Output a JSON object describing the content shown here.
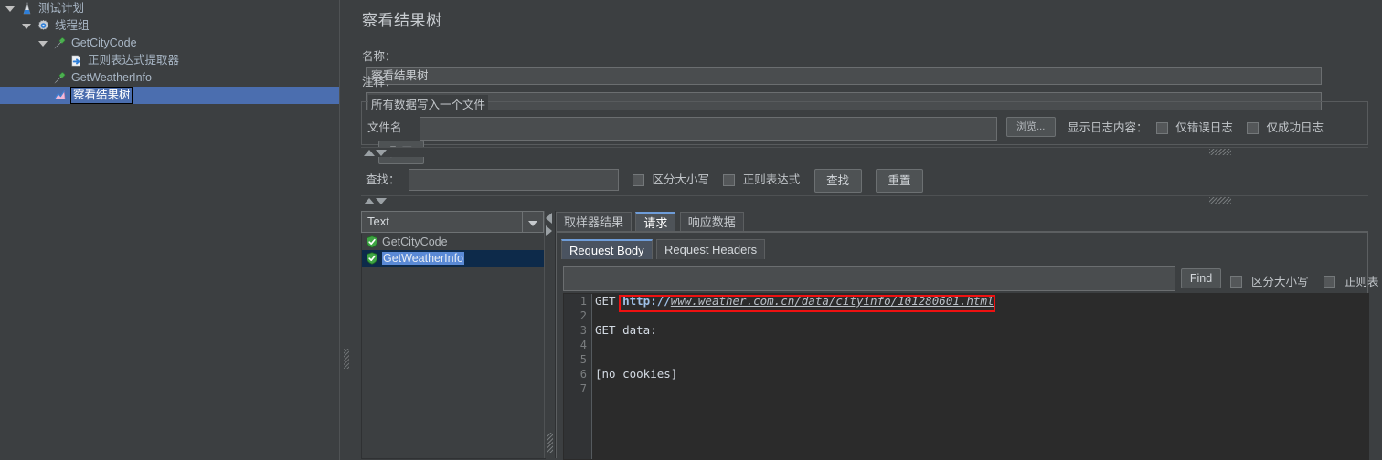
{
  "tree": {
    "items": [
      {
        "label": "测试计划",
        "icon": "test-plan-icon",
        "indent": 0,
        "toggle": "open",
        "selected": false
      },
      {
        "label": "线程组",
        "icon": "thread-group-icon",
        "indent": 1,
        "toggle": "open",
        "selected": false
      },
      {
        "label": "GetCityCode",
        "icon": "http-request-icon",
        "indent": 2,
        "toggle": "open",
        "selected": false
      },
      {
        "label": "正则表达式提取器",
        "icon": "regex-extractor-icon",
        "indent": 3,
        "toggle": "none",
        "selected": false
      },
      {
        "label": "GetWeatherInfo",
        "icon": "http-request-icon",
        "indent": 2,
        "toggle": "none",
        "selected": false
      },
      {
        "label": "察看结果树",
        "icon": "view-results-tree-icon",
        "indent": 2,
        "toggle": "none",
        "selected": true
      }
    ]
  },
  "panel": {
    "title": "察看结果树",
    "name_label": "名称：",
    "name_value": "察看结果树",
    "comment_label": "注释：",
    "comment_value": "",
    "filegroup": {
      "title": "所有数据写入一个文件",
      "filename_label": "文件名",
      "filename_value": "",
      "browse_button": "浏览...",
      "log_display_label": "显示日志内容：",
      "errors_only_label": "仅错误日志",
      "success_only_label": "仅成功日志",
      "configure_button": "配置"
    },
    "search": {
      "label": "查找：",
      "value": "",
      "case_sensitive_label": "区分大小写",
      "regex_label": "正则表达式",
      "find_button": "查找",
      "reset_button": "重置"
    }
  },
  "results": {
    "renderer_selected": "Text",
    "items": [
      {
        "label": "GetCityCode",
        "status": "success",
        "selected": false
      },
      {
        "label": "GetWeatherInfo",
        "status": "success",
        "selected": true
      }
    ]
  },
  "detail": {
    "tabs": [
      {
        "label": "取样器结果",
        "active": false
      },
      {
        "label": "请求",
        "active": true
      },
      {
        "label": "响应数据",
        "active": false
      }
    ],
    "subtabs": [
      {
        "label": "Request Body",
        "active": true
      },
      {
        "label": "Request Headers",
        "active": false
      }
    ],
    "find": {
      "value": "",
      "find_button": "Find",
      "case_sensitive_label": "区分大小写",
      "regex_label": "正则表达式"
    },
    "editor": {
      "line_numbers": [
        "1",
        "2",
        "3",
        "4",
        "5",
        "6",
        "7"
      ],
      "lines": [
        {
          "prefix": "GET ",
          "protocol": "http://",
          "url": "www.weather.com.cn/data/cityinfo/101280601.html",
          "highlighted": true
        },
        {
          "prefix": "",
          "protocol": "",
          "url": "",
          "highlighted": false
        },
        {
          "prefix": "GET data:",
          "protocol": "",
          "url": "",
          "highlighted": false
        },
        {
          "prefix": "",
          "protocol": "",
          "url": "",
          "highlighted": false
        },
        {
          "prefix": "",
          "protocol": "",
          "url": "",
          "highlighted": false
        },
        {
          "prefix": "[no cookies]",
          "protocol": "",
          "url": "",
          "highlighted": false
        },
        {
          "prefix": "",
          "protocol": "",
          "url": "",
          "highlighted": false
        }
      ]
    }
  },
  "colors": {
    "background": "#3c3f41",
    "selection_blue": "#4b6eaf",
    "editor_background": "#2b2b2b",
    "highlight_red": "#ee1111",
    "list_selection": "#5a8ad6"
  }
}
